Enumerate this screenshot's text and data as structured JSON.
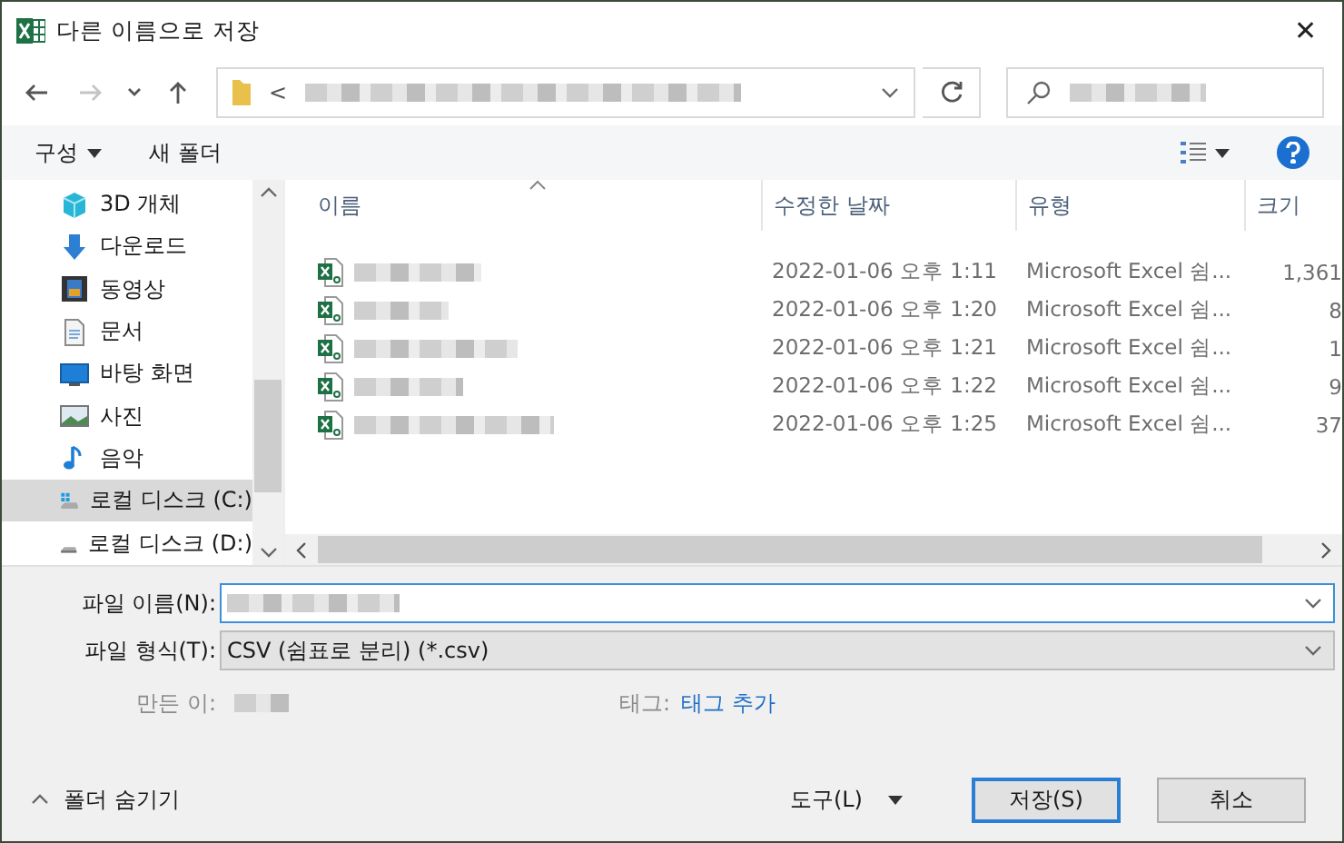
{
  "window": {
    "title": "다른 이름으로 저장",
    "close": "✕"
  },
  "address_bar": {
    "path_prefix": "<"
  },
  "nav_buttons": [
    {
      "kind": "back",
      "disabled": false
    },
    {
      "kind": "forward",
      "disabled": true
    },
    {
      "kind": "recent",
      "disabled": false
    },
    {
      "kind": "up",
      "disabled": false
    }
  ],
  "toolbar": {
    "organize": "구성",
    "new_folder": "새 폴더"
  },
  "sidebar": {
    "items": [
      {
        "kind": "cube",
        "label": "3D 개체",
        "selected": false
      },
      {
        "kind": "download",
        "label": "다운로드",
        "selected": false
      },
      {
        "kind": "video",
        "label": "동영상",
        "selected": false
      },
      {
        "kind": "document",
        "label": "문서",
        "selected": false
      },
      {
        "kind": "desktop",
        "label": "바탕 화면",
        "selected": false
      },
      {
        "kind": "picture",
        "label": "사진",
        "selected": false
      },
      {
        "kind": "music",
        "label": "음악",
        "selected": false
      },
      {
        "kind": "drive",
        "label": "로컬 디스크 (C:)",
        "selected": true
      },
      {
        "kind": "drive2",
        "label": "로컬 디스크 (D:)",
        "selected": false
      }
    ]
  },
  "table": {
    "columns": [
      "이름",
      "수정한 날짜",
      "유형",
      "크기"
    ],
    "rows": [
      {
        "modified": "2022-01-06 오후 1:11",
        "type": "Microsoft Excel 쉼...",
        "size": "1,361"
      },
      {
        "modified": "2022-01-06 오후 1:20",
        "type": "Microsoft Excel 쉼...",
        "size": "8"
      },
      {
        "modified": "2022-01-06 오후 1:21",
        "type": "Microsoft Excel 쉼...",
        "size": "1"
      },
      {
        "modified": "2022-01-06 오후 1:22",
        "type": "Microsoft Excel 쉼...",
        "size": "9"
      },
      {
        "modified": "2022-01-06 오후 1:25",
        "type": "Microsoft Excel 쉼...",
        "size": "37"
      }
    ]
  },
  "form": {
    "filename_label": "파일 이름(N):",
    "filetype_label": "파일 형식(T):",
    "filetype_value": "CSV (쉼표로 분리) (*.csv)",
    "author_label": "만든 이:",
    "tags_label": "태그:",
    "tags_link": "태그 추가"
  },
  "footer": {
    "hide_folders": "폴더 숨기기",
    "tools": "도구(L)",
    "save": "저장(S)",
    "cancel": "취소"
  }
}
